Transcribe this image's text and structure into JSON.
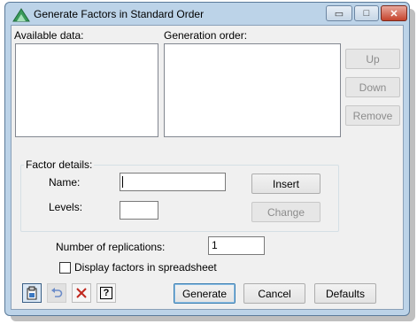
{
  "window": {
    "title": "Generate Factors in Standard Order",
    "minimize_glyph": "▭",
    "maximize_glyph": "□",
    "close_glyph": "✕"
  },
  "lists": {
    "available_label": "Available data:",
    "order_label": "Generation order:"
  },
  "order_buttons": {
    "up": "Up",
    "down": "Down",
    "remove": "Remove"
  },
  "factor_details": {
    "group_label": "Factor details:",
    "name_label": "Name:",
    "name_value": "",
    "levels_label": "Levels:",
    "levels_value": "",
    "insert": "Insert",
    "change": "Change"
  },
  "replications": {
    "label": "Number of replications:",
    "value": "1"
  },
  "spreadsheet_option": {
    "label": "Display factors in spreadsheet",
    "checked": false
  },
  "footer": {
    "generate": "Generate",
    "cancel": "Cancel",
    "defaults": "Defaults",
    "help_glyph": "?"
  },
  "icons": {
    "app": "genstat-triangle-icon",
    "copy": "clipboard-icon",
    "undo": "undo-icon",
    "clear": "clear-x-icon",
    "help": "help-icon"
  }
}
